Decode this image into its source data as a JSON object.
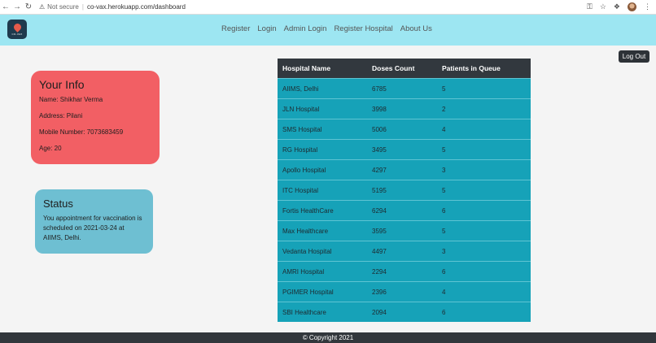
{
  "browser": {
    "security_label": "Not secure",
    "url": "co-vax.herokuapp.com/dashboard"
  },
  "navbar": {
    "logo_text": "CO-VAX",
    "links": [
      "Register",
      "Login",
      "Admin Login",
      "Register Hospital",
      "About Us"
    ]
  },
  "logout_label": "Log Out",
  "info": {
    "title": "Your Info",
    "name": "Name: Shikhar Verma",
    "address": "Address: Pilani",
    "mobile": "Mobile Number: 7073683459",
    "age": "Age: 20"
  },
  "status": {
    "title": "Status",
    "message": "You appointment for vaccination is scheduled on 2021-03-24 at AIIMS, Delhi."
  },
  "table": {
    "headers": [
      "Hospital Name",
      "Doses Count",
      "Patients in Queue"
    ],
    "rows": [
      [
        "AIIMS, Delhi",
        "6785",
        "5"
      ],
      [
        "JLN Hospital",
        "3998",
        "2"
      ],
      [
        "SMS Hospital",
        "5006",
        "4"
      ],
      [
        "RG Hospital",
        "3495",
        "5"
      ],
      [
        "Apollo Hospital",
        "4297",
        "3"
      ],
      [
        "ITC Hospital",
        "5195",
        "5"
      ],
      [
        "Fortis HealthCare",
        "6294",
        "6"
      ],
      [
        "Max Healthcare",
        "3595",
        "5"
      ],
      [
        "Vedanta Hospital",
        "4497",
        "3"
      ],
      [
        "AMRI Hospital",
        "2294",
        "6"
      ],
      [
        "PGIMER Hospital",
        "2396",
        "4"
      ],
      [
        "SBI Healthcare",
        "2094",
        "6"
      ]
    ]
  },
  "footer": "© Copyright 2021",
  "colors": {
    "navbar": "#9de6f2",
    "info_card": "#f25f64",
    "status_card": "#6ebfd2",
    "table_row": "#16a2b8",
    "table_header": "#32383e",
    "footer": "#32373c"
  }
}
